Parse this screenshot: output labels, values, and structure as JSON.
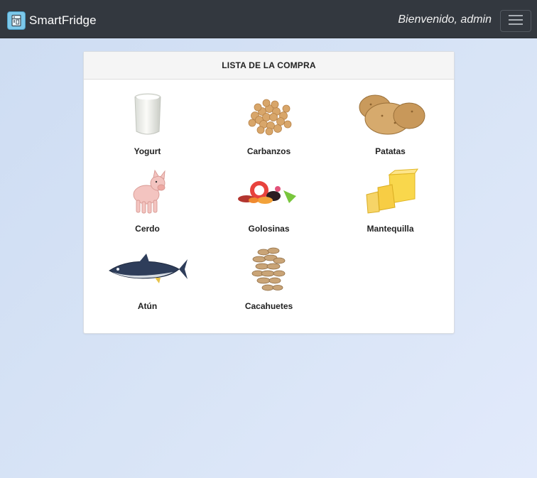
{
  "navbar": {
    "brand": "SmartFridge",
    "welcome": "Bienvenido, admin"
  },
  "card": {
    "title": "LISTA DE LA COMPRA",
    "items": [
      {
        "label": "Yogurt",
        "icon": "yogurt-icon"
      },
      {
        "label": "Carbanzos",
        "icon": "chickpeas-icon"
      },
      {
        "label": "Patatas",
        "icon": "potatoes-icon"
      },
      {
        "label": "Cerdo",
        "icon": "pig-icon"
      },
      {
        "label": "Golosinas",
        "icon": "candy-icon"
      },
      {
        "label": "Mantequilla",
        "icon": "butter-icon"
      },
      {
        "label": "Atún",
        "icon": "tuna-icon"
      },
      {
        "label": "Cacahuetes",
        "icon": "peanuts-icon"
      }
    ]
  }
}
